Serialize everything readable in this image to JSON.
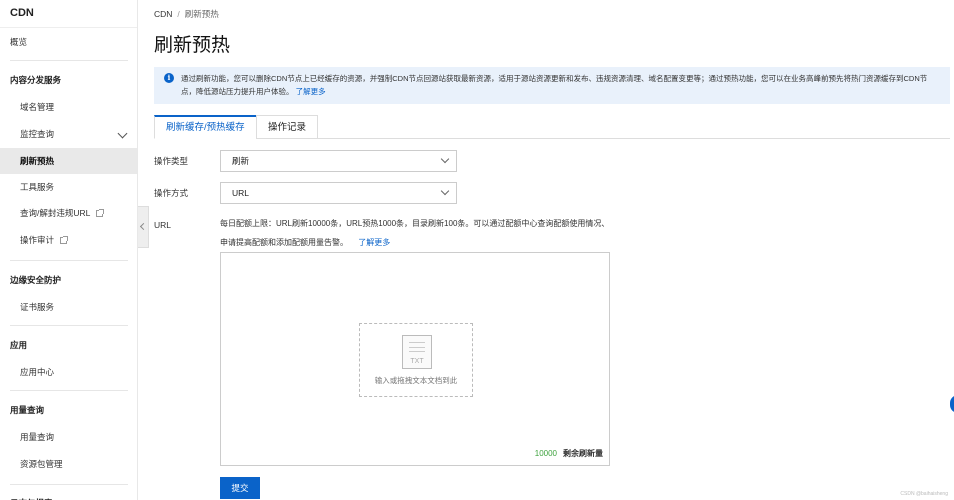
{
  "sidebar": {
    "title": "CDN",
    "overview": "概览",
    "groups": {
      "content": "内容分发服务",
      "edge": "边缘安全防护",
      "app": "应用",
      "usage": "用量查询",
      "log": "日志与报表"
    },
    "items": {
      "domain": "域名管理",
      "monitor": "监控查询",
      "refresh": "刷新预热",
      "tools": "工具服务",
      "block": "查询/解封违规URL",
      "audit": "操作审计",
      "cert": "证书服务",
      "appcenter": "应用中心",
      "usage": "用量查询",
      "package": "资源包管理"
    }
  },
  "breadcrumb": {
    "root": "CDN",
    "sep": "/",
    "current": "刷新预热"
  },
  "page_title": "刷新预热",
  "notice": {
    "text": "通过刷新功能，您可以删除CDN节点上已经缓存的资源，并强制CDN节点回源站获取最新资源，适用于源站资源更新和发布、违规资源清理、域名配置变更等；通过预热功能，您可以在业务高峰前预先将热门资源缓存到CDN节点，降低源站压力提升用户体验。",
    "link": "了解更多"
  },
  "tabs": {
    "refresh": "刷新缓存/预热缓存",
    "history": "操作记录"
  },
  "form": {
    "op_type_label": "操作类型",
    "op_type_value": "刷新",
    "op_mode_label": "操作方式",
    "op_mode_value": "URL",
    "url_label": "URL",
    "url_hint": "每日配额上限：URL刷新10000条，URL预热1000条，目录刷新100条。可以通过配额中心查询配额使用情况、申请提高配额和添加配额用量告警。",
    "url_hint_link": "了解更多",
    "txt_icon": "TXT",
    "dropzone_text": "输入或拖拽文本文档到此",
    "remaining_count": "10000",
    "remaining_label": "剩余刷新量",
    "submit": "提交"
  },
  "watermark": "CSDN @baihaisheng",
  "icons": {
    "info": "info-icon",
    "chevron": "chevron-down-icon",
    "external": "external-link-icon",
    "txt": "txt-file-icon"
  },
  "colors": {
    "accent": "#0a63c9",
    "notice_bg": "#e9f1fb",
    "success": "#3fa33f"
  }
}
